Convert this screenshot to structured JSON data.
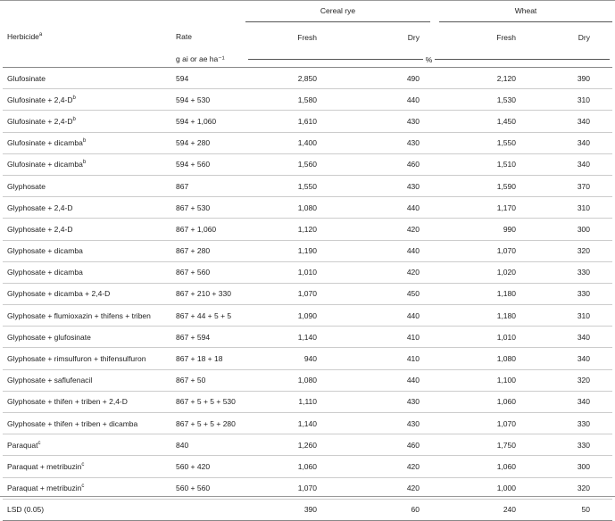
{
  "header": {
    "group_cereal_rye": "Cereal rye",
    "group_wheat": "Wheat",
    "col_herbicide": "Herbicide",
    "col_herbicide_sup": "a",
    "col_rate": "Rate",
    "col_fresh": "Fresh",
    "col_dry": "Dry",
    "unit_rate": "g ai or ae ha⁻¹",
    "unit_percent": "%"
  },
  "rows": [
    {
      "herbicide": "Glufosinate",
      "sup": "",
      "rate": "594",
      "rye_fresh": "2,850",
      "rye_dry": "490",
      "wheat_fresh": "2,120",
      "wheat_dry": "390"
    },
    {
      "herbicide": "Glufosinate + 2,4-D",
      "sup": "b",
      "rate": "594 + 530",
      "rye_fresh": "1,580",
      "rye_dry": "440",
      "wheat_fresh": "1,530",
      "wheat_dry": "310"
    },
    {
      "herbicide": "Glufosinate + 2,4-D",
      "sup": "b",
      "rate": "594 + 1,060",
      "rye_fresh": "1,610",
      "rye_dry": "430",
      "wheat_fresh": "1,450",
      "wheat_dry": "340"
    },
    {
      "herbicide": "Glufosinate + dicamba",
      "sup": "b",
      "rate": "594 + 280",
      "rye_fresh": "1,400",
      "rye_dry": "430",
      "wheat_fresh": "1,550",
      "wheat_dry": "340"
    },
    {
      "herbicide": "Glufosinate + dicamba",
      "sup": "b",
      "rate": "594 + 560",
      "rye_fresh": "1,560",
      "rye_dry": "460",
      "wheat_fresh": "1,510",
      "wheat_dry": "340"
    },
    {
      "herbicide": "Glyphosate",
      "sup": "",
      "rate": "867",
      "rye_fresh": "1,550",
      "rye_dry": "430",
      "wheat_fresh": "1,590",
      "wheat_dry": "370"
    },
    {
      "herbicide": "Glyphosate + 2,4-D",
      "sup": "",
      "rate": "867 + 530",
      "rye_fresh": "1,080",
      "rye_dry": "440",
      "wheat_fresh": "1,170",
      "wheat_dry": "310"
    },
    {
      "herbicide": "Glyphosate + 2,4-D",
      "sup": "",
      "rate": "867 + 1,060",
      "rye_fresh": "1,120",
      "rye_dry": "420",
      "wheat_fresh": "990",
      "wheat_dry": "300"
    },
    {
      "herbicide": "Glyphosate + dicamba",
      "sup": "",
      "rate": "867 + 280",
      "rye_fresh": "1,190",
      "rye_dry": "440",
      "wheat_fresh": "1,070",
      "wheat_dry": "320"
    },
    {
      "herbicide": "Glyphosate + dicamba",
      "sup": "",
      "rate": "867 + 560",
      "rye_fresh": "1,010",
      "rye_dry": "420",
      "wheat_fresh": "1,020",
      "wheat_dry": "330"
    },
    {
      "herbicide": "Glyphosate + dicamba + 2,4-D",
      "sup": "",
      "rate": "867 + 210 + 330",
      "rye_fresh": "1,070",
      "rye_dry": "450",
      "wheat_fresh": "1,180",
      "wheat_dry": "330"
    },
    {
      "herbicide": "Glyphosate + flumioxazin + thifens + triben",
      "sup": "",
      "rate": "867 + 44 + 5 + 5",
      "rye_fresh": "1,090",
      "rye_dry": "440",
      "wheat_fresh": "1,180",
      "wheat_dry": "310"
    },
    {
      "herbicide": "Glyphosate + glufosinate",
      "sup": "",
      "rate": "867 + 594",
      "rye_fresh": "1,140",
      "rye_dry": "410",
      "wheat_fresh": "1,010",
      "wheat_dry": "340"
    },
    {
      "herbicide": "Glyphosate + rimsulfuron + thifensulfuron",
      "sup": "",
      "rate": "867 + 18 + 18",
      "rye_fresh": "940",
      "rye_dry": "410",
      "wheat_fresh": "1,080",
      "wheat_dry": "340"
    },
    {
      "herbicide": "Glyphosate + saflufenacil",
      "sup": "",
      "rate": "867 + 50",
      "rye_fresh": "1,080",
      "rye_dry": "440",
      "wheat_fresh": "1,100",
      "wheat_dry": "320"
    },
    {
      "herbicide": "Glyphosate + thifen + triben + 2,4-D",
      "sup": "",
      "rate": "867 + 5 + 5 + 530",
      "rye_fresh": "1,110",
      "rye_dry": "430",
      "wheat_fresh": "1,060",
      "wheat_dry": "340"
    },
    {
      "herbicide": "Glyphosate + thifen + triben + dicamba",
      "sup": "",
      "rate": "867 + 5 + 5 + 280",
      "rye_fresh": "1,140",
      "rye_dry": "430",
      "wheat_fresh": "1,070",
      "wheat_dry": "330"
    },
    {
      "herbicide": "Paraquat",
      "sup": "c",
      "rate": "840",
      "rye_fresh": "1,260",
      "rye_dry": "460",
      "wheat_fresh": "1,750",
      "wheat_dry": "330"
    },
    {
      "herbicide": "Paraquat + metribuzin",
      "sup": "c",
      "rate": "560 + 420",
      "rye_fresh": "1,060",
      "rye_dry": "420",
      "wheat_fresh": "1,060",
      "wheat_dry": "300"
    },
    {
      "herbicide": "Paraquat + metribuzin",
      "sup": "c",
      "rate": "560 + 560",
      "rye_fresh": "1,070",
      "rye_dry": "420",
      "wheat_fresh": "1,000",
      "wheat_dry": "320"
    },
    {
      "herbicide": "LSD (0.05)",
      "sup": "",
      "rate": "",
      "rye_fresh": "390",
      "rye_dry": "60",
      "wheat_fresh": "240",
      "wheat_dry": "50"
    }
  ]
}
